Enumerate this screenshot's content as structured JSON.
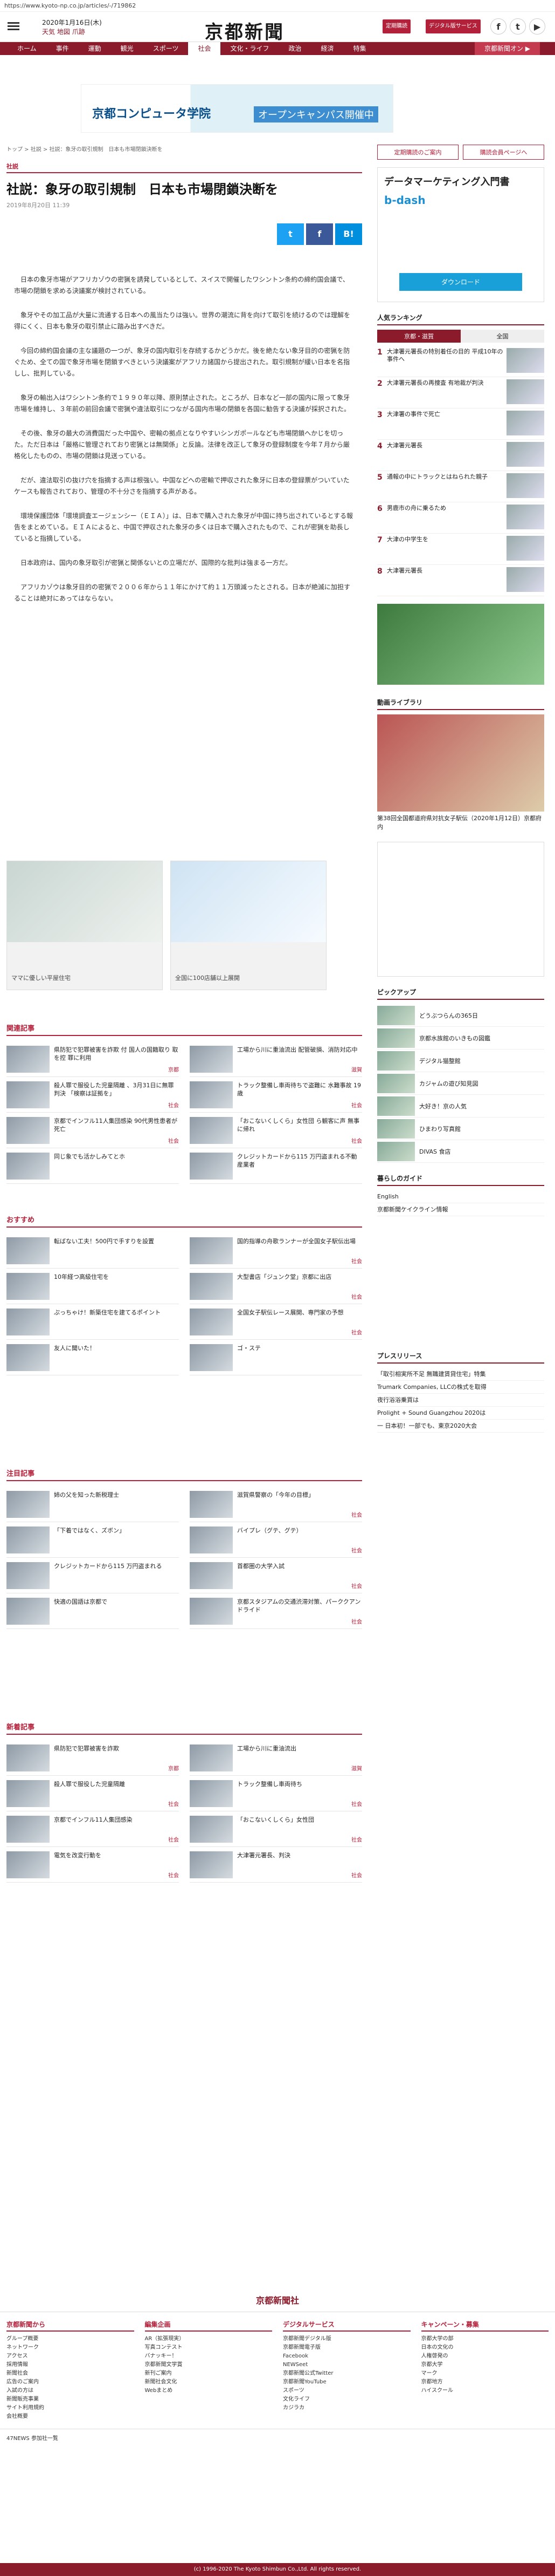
{
  "url": "https://www.kyoto-np.co.jp/articles/-/719862",
  "header": {
    "date": "2020年1月16日(木)",
    "weather": [
      "天気",
      "地図",
      "爪跡"
    ],
    "logo": "京都新聞",
    "btn1": "定期購読",
    "btn2": "デジタル版サービス",
    "fb": "f",
    "tw": "t",
    "yt": "▶",
    "fb_l": "Facebook",
    "tw_l": "Twitter",
    "yt_l": "YouTube"
  },
  "nav": [
    "ホーム",
    "事件",
    "運動",
    "観光",
    "スポーツ",
    "社会",
    "文化・ライフ",
    "政治",
    "経済",
    "特集"
  ],
  "nav_ext": "京都新聞オン ▶",
  "ad": {
    "t1": "京都コンピュータ学院",
    "t2": "オープンキャンパス開催中"
  },
  "crumb": "トップ > 社説 > 社説：象牙の取引規制　日本も市場閉鎖決断を",
  "article": {
    "cat": "社説",
    "title": "社説：象牙の取引規制　日本も市場閉鎖決断を",
    "date": "2019年8月20日 11:39",
    "paras": [
      "日本の象牙市場がアフリカゾウの密猟を誘発しているとして、スイスで開催したワシントン条約の締約国会議で、市場の閉鎖を求める決議案が検討されている。",
      "象牙やその加工品が大量に流通する日本への風当たりは強い。世界の潮流に背を向けて取引を続けるのでは理解を得にくく、日本も象牙の取引禁止に踏み出すべきだ。",
      "今回の締約国会議の主な議題の一つが、象牙の国内取引を存続するかどうかだ。後を絶たない象牙目的の密猟を防ぐため、全ての国で象牙市場を閉鎖すべきという決議案がアフリカ諸国から提出された。取引規制が緩い日本を名指しし、批判している。",
      "象牙の輸出入はワシントン条約で１９９０年以降、原則禁止された。ところが、日本など一部の国内に限って象牙市場を維持し、３年前の前回会議で密猟や違法取引につながる国内市場の閉鎖を各国に勧告する決議が採択された。",
      "その後、象牙の最大の消費国だった中国や、密輸の拠点となりやすいシンガポールなども市場閉鎖へかじを切った。ただ日本は「厳格に管理されており密猟とは無関係」と反論。法律を改正して象牙の登録制度を今年７月から厳格化したものの、市場の閉鎖は見送っている。",
      "だが、違法取引の抜け穴を指摘する声は根強い。中国などへの密輸で押収された象牙に日本の登録票がついていたケースも報告されており、管理の不十分さを指摘する声がある。",
      "環境保護団体「環境調査エージェンシー（ＥＩＡ）」は、日本で購入された象牙が中国に持ち出されているとする報告をまとめている。ＥＩＡによると、中国で押収された象牙の多くは日本で購入されたもので、これが密猟を助長していると指摘している。",
      "日本政府は、国内の象牙取引が密猟と関係ないとの立場だが、国際的な批判は強まる一方だ。",
      "アフリカゾウは象牙目的の密猟で２００６年から１１年にかけて約１１万頭減ったとされる。日本が絶滅に加担することは絶対にあってはならない。"
    ],
    "share_tw": "t",
    "share_fb": "f",
    "share_bi": "B!"
  },
  "ads2": [
    {
      "cap": "ママに優しい平屋住宅"
    },
    {
      "cap": "全国に100店舗以上展開"
    }
  ],
  "related": {
    "title": "関連記事",
    "items": [
      {
        "tx": "県防犯で犯罪被害を詐欺 付 国人の国籍取り 取を控 罪に利用",
        "tag": "京都"
      },
      {
        "tx": "工場から川に重油流出 配管破損、消防対応中",
        "tag": "滋賀"
      },
      {
        "tx": "殺人罪で服役した児童隔離 、3月31日に無罪判決 「検察は証拠を」",
        "tag": "社会"
      },
      {
        "tx": "トラック整備し車両待ちで盗難に 水難事故 19歳",
        "tag": "社会"
      },
      {
        "tx": "京都でインフル11人集団感染 90代男性患者が死亡",
        "tag": "社会"
      },
      {
        "tx": "「おこないくしくら」女性団 ら観客に声 無事に帰れ",
        "tag": "社会"
      },
      {
        "tx": "同じ象でも活かしみてとホ",
        "tag": ""
      },
      {
        "tx": "クレジットカードから115 万円盗まれる不動産業者",
        "tag": ""
      }
    ]
  },
  "recommend": {
    "title": "おすすめ",
    "items": [
      {
        "tx": "転ばない工夫！500円で手すりを設置",
        "tag": ""
      },
      {
        "tx": "国的指導の舟歌ランナーが全国女子駅伝出場",
        "tag": "社会"
      },
      {
        "tx": "10年経つ高級住宅を",
        "tag": ""
      },
      {
        "tx": "大型書店「ジュンク堂」京都に出店",
        "tag": "社会"
      },
      {
        "tx": "ぷっちゃけ！新築住宅を建てるポイント",
        "tag": ""
      },
      {
        "tx": "全国女子駅伝レース展開、専門家の予想",
        "tag": "社会"
      },
      {
        "tx": "友人に聞いた！",
        "tag": ""
      },
      {
        "tx": "ゴ・ステ",
        "tag": ""
      }
    ]
  },
  "attention": {
    "title": "注目記事",
    "items": [
      {
        "tx": "姉の父を知った新税理士",
        "tag": ""
      },
      {
        "tx": "滋賀県警察の「今年の目標」",
        "tag": "社会"
      },
      {
        "tx": "「下着ではなく、ズボン」",
        "tag": ""
      },
      {
        "tx": "バイプレ（グテ、グテ）",
        "tag": "社会"
      },
      {
        "tx": "クレジットカードから115 万円盗まれる",
        "tag": ""
      },
      {
        "tx": "首都圏の大学入試",
        "tag": "社会"
      },
      {
        "tx": "快適の国語は京都で",
        "tag": ""
      },
      {
        "tx": "京都スタジアムの交通渋滞対策、パーククアンドライド",
        "tag": "社会"
      }
    ]
  },
  "newest": {
    "title": "新着記事",
    "items": [
      {
        "tx": "県防犯で犯罪被害を詐欺",
        "tag": "京都"
      },
      {
        "tx": "工場から川に重油流出",
        "tag": "滋賀"
      },
      {
        "tx": "殺人罪で服役した児童隔離",
        "tag": "社会"
      },
      {
        "tx": "トラック整備し車両待ち",
        "tag": "社会"
      },
      {
        "tx": "京都でインフル11人集団感染",
        "tag": "社会"
      },
      {
        "tx": "「おこないくしくら」女性団",
        "tag": "社会"
      },
      {
        "tx": "電気を改変行動を",
        "tag": "社会"
      },
      {
        "tx": "大津署元署長、判決",
        "tag": "社会"
      }
    ]
  },
  "sidebar": {
    "btn1": "定期購読のご案内",
    "btn2": "購読会員ページへ",
    "ad_name": "データマーケティング入門書",
    "ad_brand": "b-dash",
    "ad_dl": "ダウンロード",
    "ranking_title": "人気ランキング",
    "rank_tabs": [
      "京都・滋賀",
      "全国"
    ],
    "ranks": [
      "大津署元署長の特別着任の目的 平成10年の事件へ",
      "大津署元署長の再捜査 有地裁が判決",
      "大津署の事件で死亡",
      "大津署元署長",
      "通報の中にトラックとはねられた親子",
      "男鹿市の舟に乗るため",
      "大津の中学生を",
      "大津署元署長"
    ],
    "lib_title": "動画ライブラリ",
    "lib_cap": "第38回全国都道府県対抗女子駅伝（2020年1月12日）京都府内",
    "pick_title": "ピックアップ",
    "picks": [
      "どうぶつらんの365日",
      "京都水族館のいきもの図鑑",
      "デジタル猫整館",
      "カジャムの遊び知見図",
      "大好き！京の人気",
      "ひまわり写真館",
      "DIVAS 食店"
    ],
    "life_title": "暮らしのガイド",
    "life": [
      "English",
      "京都新聞ケイクライン情報"
    ],
    "pr_title": "プレスリリース",
    "prs": [
      "「取引相実所不足 無職建賃貸住宅」特集",
      "Trumark Companies, LLCの株式を取得",
      "夜行浴浴乗買は",
      "Prolight + Sound Guangzhou 2020は",
      "一 日本初！一部でも、東京2020大会"
    ]
  },
  "footer": {
    "logo": "京都新聞社",
    "cols": [
      {
        "h": "京都新聞から",
        "items": [
          "グループ概要",
          "ネットワーク",
          "アクセス",
          "採用情報",
          "新聞社会",
          "広告のご案内",
          "入試の方は",
          "新聞販売事業",
          "サイト利用規約",
          "会社概要"
        ]
      },
      {
        "h": "編集企画",
        "items": [
          "AR（拡張現実）",
          "写真コンテスト",
          "バナッキー！",
          "京都新聞文学賞",
          "新刊ご案内",
          "新聞社会文化",
          "Webまとめ"
        ]
      },
      {
        "h": "デジタルサービス",
        "items": [
          "京都新聞デジタル版",
          "京都新聞電子版",
          "Facebook",
          "NEWSeet",
          "京都新聞公式Twitter",
          "京都新聞YouTube",
          "スポーツ",
          "文化ライフ",
          "カジラカ"
        ]
      },
      {
        "h": "キャンペーン・募集",
        "items": [
          "京都大学の部",
          "日本の文化の",
          "人権啓発の",
          "京都大学",
          "マーク",
          "京都地方",
          "ハイスクール"
        ]
      }
    ]
  },
  "knews": "47NEWS 参加社一覧",
  "copyright": "(c) 1996-2020 The Kyoto Shimbun Co.,Ltd. All rights reserved."
}
